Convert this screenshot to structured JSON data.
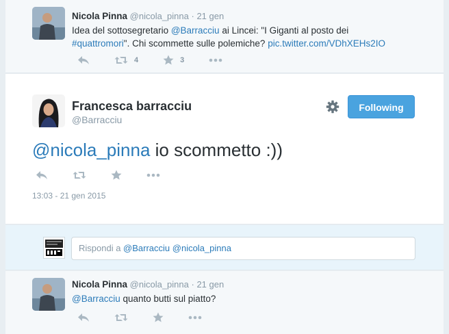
{
  "tweet1": {
    "name": "Nicola Pinna",
    "handle": "@nicola_pinna",
    "dot": "·",
    "time": "21 gen",
    "text_1": "Idea del sottosegretario ",
    "mention": "@Barracciu",
    "text_2": " ai Lincei: \"I Giganti al posto dei",
    "hashtag": "#quattromori",
    "text_3": "\". Chi scommette sulle polemiche? ",
    "pic_link": "pic.twitter.com/VDhXEHs2IO",
    "retweet_count": "4",
    "favorite_count": "3"
  },
  "focus_tweet": {
    "name": "Francesca barracciu",
    "handle": "@Barracciu",
    "follow_label": "Following",
    "mention": "@nicola_pinna",
    "text": " io scommetto :))",
    "date": "13:03 - 21 gen 2015"
  },
  "reply": {
    "prefix": "Rispondi a ",
    "mentions": "@Barracciu @nicola_pinna"
  },
  "tweet2": {
    "name": "Nicola Pinna",
    "handle": "@nicola_pinna",
    "dot": "·",
    "time": "21 gen",
    "mention": "@Barracciu",
    "text": " quanto butti sul piatto?"
  },
  "colors": {
    "link": "#2b7bb9",
    "follow_button": "#4aa3df",
    "page_bg": "#e8eef2"
  },
  "icons": [
    "reply-icon",
    "retweet-icon",
    "favorite-icon",
    "more-icon",
    "gear-icon"
  ]
}
